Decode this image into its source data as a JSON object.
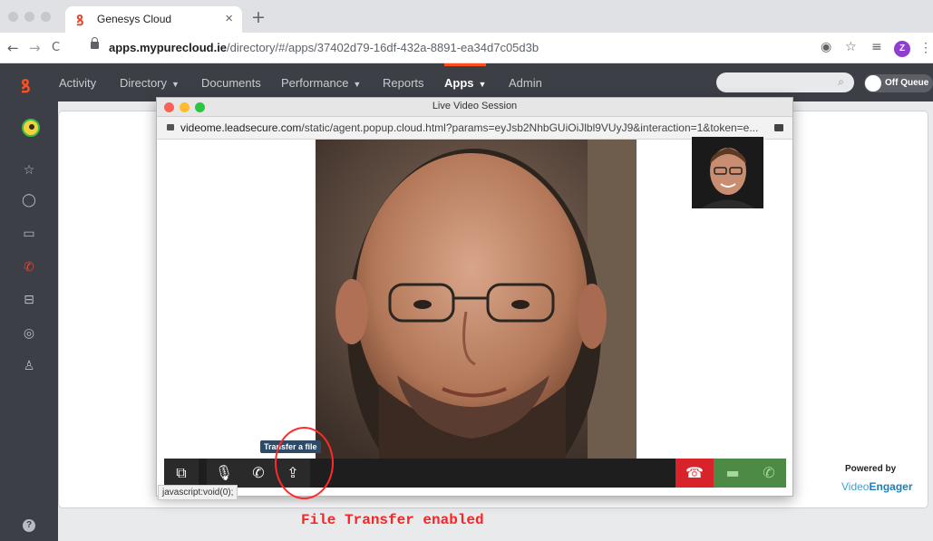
{
  "browser": {
    "tab_title": "Genesys Cloud",
    "tab_close": "×",
    "new_tab": "+",
    "back": "←",
    "forward": "→",
    "reload": "C",
    "url_host": "apps.mypurecloud.ie",
    "url_path": "/directory/#/apps/37402d79-16df-432a-8891-ea34d7c05d3b",
    "profile_initial": "Z"
  },
  "nav": {
    "items": [
      {
        "label": "Activity",
        "caret": ""
      },
      {
        "label": "Directory",
        "caret": "▼"
      },
      {
        "label": "Documents",
        "caret": ""
      },
      {
        "label": "Performance",
        "caret": "▼"
      },
      {
        "label": "Reports",
        "caret": ""
      },
      {
        "label": "Apps",
        "caret": "▼"
      },
      {
        "label": "Admin",
        "caret": ""
      }
    ],
    "active": "Apps",
    "queue_toggle": "Off Queue",
    "accent": "#ff4f1f"
  },
  "rail": {
    "icons": [
      "star-icon",
      "chat-icon",
      "video-icon",
      "phone-icon",
      "inbox-icon",
      "support-icon",
      "person-audio-icon"
    ],
    "help": "?"
  },
  "popup": {
    "window_title": "Live Video Session",
    "url_host": "videome.leadsecure.com",
    "url_path": "/static/agent.popup.cloud.html?params=eyJsb2NhbGUiOiJlbl9VUyJ9&interaction=1&token=e...",
    "tooltip": "Transfer a file",
    "status_url": "javascript:void(0);"
  },
  "branding": {
    "powered_by": "Powered by",
    "logo_light": "Video",
    "logo_bold": "Engager"
  },
  "annotation": {
    "text": "File Transfer enabled",
    "color": "#ff2222"
  }
}
